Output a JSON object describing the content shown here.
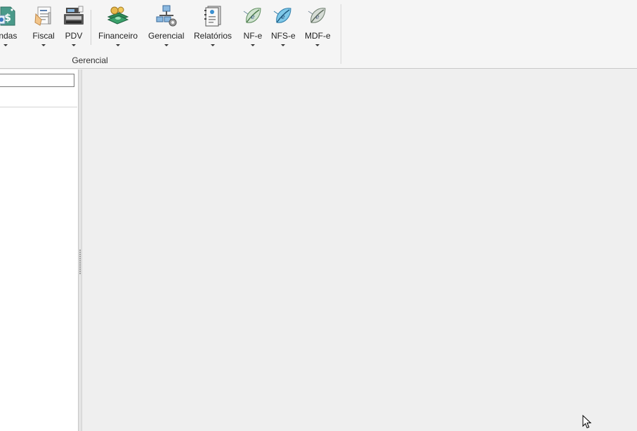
{
  "ribbon": {
    "group_label": "Gerencial",
    "buttons": [
      {
        "label": "endas",
        "icon": "sales-tag-dollar-icon"
      },
      {
        "label": "Fiscal",
        "icon": "fiscal-documents-icon"
      },
      {
        "label": "PDV",
        "icon": "cash-register-icon"
      },
      {
        "label": "Financeiro",
        "icon": "money-stack-icon"
      },
      {
        "label": "Gerencial",
        "icon": "network-gear-icon"
      },
      {
        "label": "Relatórios",
        "icon": "report-notebook-icon"
      },
      {
        "label": "NF-e",
        "icon": "nfe-leaf-icon"
      },
      {
        "label": "NFS-e",
        "icon": "nfse-leaf-icon"
      },
      {
        "label": "MDF-e",
        "icon": "mdfe-leaf-icon"
      }
    ]
  },
  "left_pane": {
    "search_value": ""
  },
  "colors": {
    "ribbon_bg": "#f5f5f5",
    "workspace_bg": "#efefef",
    "pane_bg": "#ffffff",
    "accent_green": "#2e8b57",
    "accent_blue": "#3a8fd0"
  }
}
